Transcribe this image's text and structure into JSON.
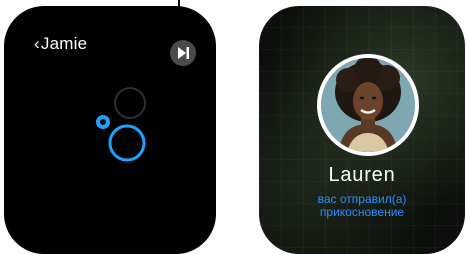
{
  "left_watch": {
    "back_label": "Jamie",
    "back_chevron": "‹",
    "control_icon": "play-pause-icon"
  },
  "right_watch": {
    "name": "Lauren",
    "message_line1": "вас отправил(а)",
    "message_line2": "прикосновение"
  },
  "colors": {
    "accent_blue": "#1ea1ff",
    "message_blue": "#2e8cff"
  }
}
